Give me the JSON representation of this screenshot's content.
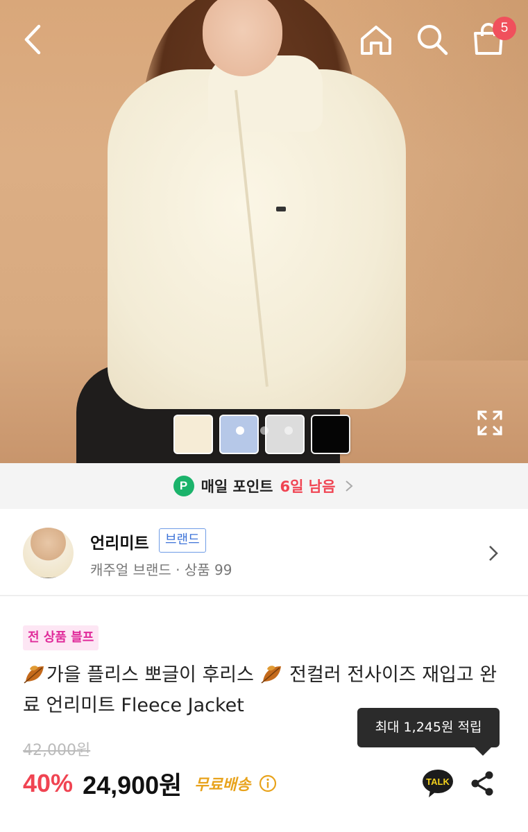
{
  "header": {
    "cart_count": "5"
  },
  "gallery": {
    "swatch_colors": [
      "#f6ecd6",
      "#b6c8e8",
      "#dcdcdc",
      "#050505"
    ],
    "pages": 3,
    "active_page": 1
  },
  "points": {
    "icon_letter": "P",
    "label": "매일 포인트",
    "days": "6일 남음"
  },
  "brand": {
    "name": "언리미트",
    "tag": "브랜드",
    "subtitle": "캐주얼 브랜드 · 상품 99"
  },
  "product": {
    "promo": "전 상품 블프",
    "title_part1": "가을 플리스 뽀글이 후리스 ",
    "title_part2": " 전컬러 전사이즈 재입고 완료 언리미트 Fleece Jacket",
    "original_price": "42,000원",
    "discount": "40%",
    "price": "24,900원",
    "shipping": "무료배송"
  },
  "tooltip": {
    "text": "최대 1,245원 적립"
  },
  "actions": {
    "talk_label": "TALK"
  }
}
